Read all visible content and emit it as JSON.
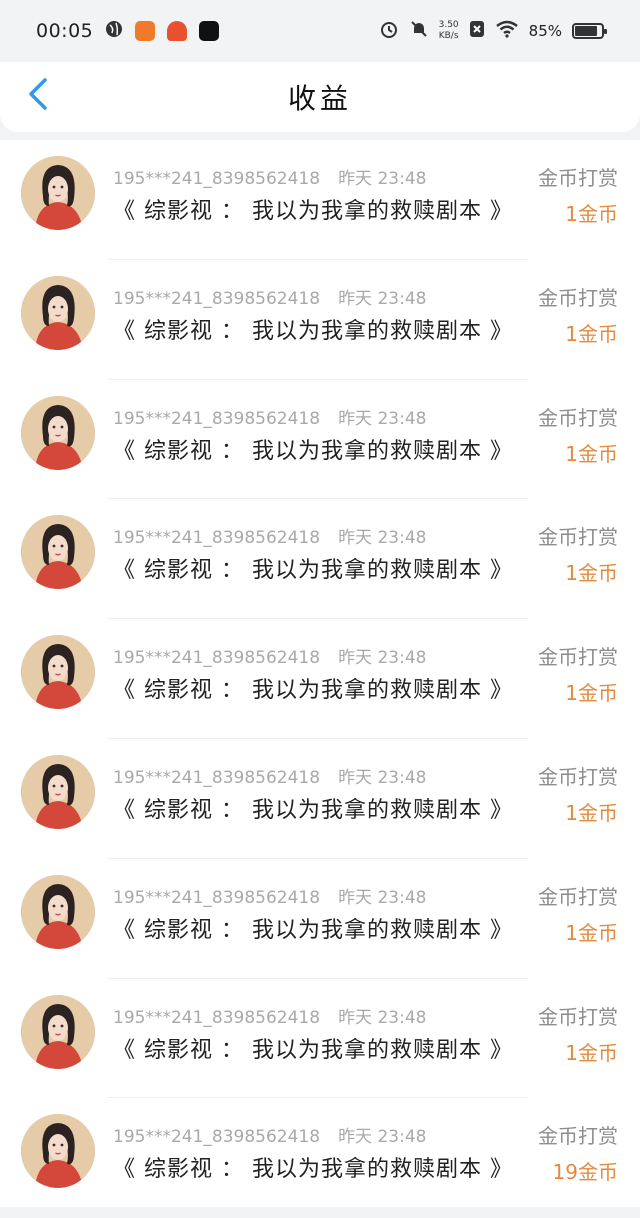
{
  "status_bar": {
    "time": "00:05",
    "net_speed_value": "3.50",
    "net_speed_unit": "KB/s",
    "battery": "85%",
    "battery_level": 0.85
  },
  "header": {
    "title": "收益",
    "back_icon": "chevron-left-icon"
  },
  "colors": {
    "accent": "#2f9ae8",
    "amount": "#e48a3c",
    "muted": "#a9a9a9"
  },
  "rows": [
    {
      "user": "195***241_8398562418",
      "time": "昨天 23:48",
      "book": "《 综影视 ： 我以为我拿的救赎剧本 》",
      "type": "金币打赏",
      "amount": "1金币"
    },
    {
      "user": "195***241_8398562418",
      "time": "昨天 23:48",
      "book": "《 综影视 ： 我以为我拿的救赎剧本 》",
      "type": "金币打赏",
      "amount": "1金币"
    },
    {
      "user": "195***241_8398562418",
      "time": "昨天 23:48",
      "book": "《 综影视 ： 我以为我拿的救赎剧本 》",
      "type": "金币打赏",
      "amount": "1金币"
    },
    {
      "user": "195***241_8398562418",
      "time": "昨天 23:48",
      "book": "《 综影视 ： 我以为我拿的救赎剧本 》",
      "type": "金币打赏",
      "amount": "1金币"
    },
    {
      "user": "195***241_8398562418",
      "time": "昨天 23:48",
      "book": "《 综影视 ： 我以为我拿的救赎剧本 》",
      "type": "金币打赏",
      "amount": "1金币"
    },
    {
      "user": "195***241_8398562418",
      "time": "昨天 23:48",
      "book": "《 综影视 ： 我以为我拿的救赎剧本 》",
      "type": "金币打赏",
      "amount": "1金币"
    },
    {
      "user": "195***241_8398562418",
      "time": "昨天 23:48",
      "book": "《 综影视 ： 我以为我拿的救赎剧本 》",
      "type": "金币打赏",
      "amount": "1金币"
    },
    {
      "user": "195***241_8398562418",
      "time": "昨天 23:48",
      "book": "《 综影视 ： 我以为我拿的救赎剧本 》",
      "type": "金币打赏",
      "amount": "1金币"
    },
    {
      "user": "195***241_8398562418",
      "time": "昨天 23:48",
      "book": "《 综影视 ： 我以为我拿的救赎剧本 》",
      "type": "金币打赏",
      "amount": "19金币"
    }
  ]
}
